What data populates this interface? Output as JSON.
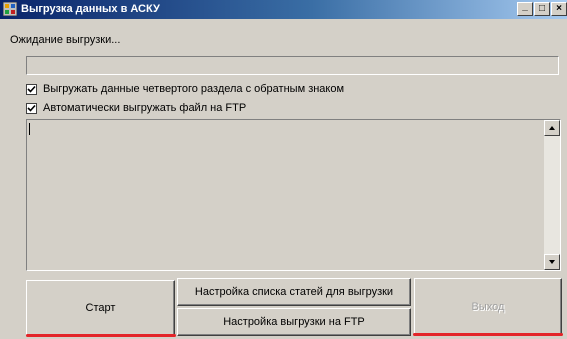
{
  "window": {
    "title": "Выгрузка данных в АСКУ",
    "controls": {
      "minimize": "_",
      "maximize": "□",
      "close": "×"
    }
  },
  "status": {
    "text": "Ожидание выгрузки..."
  },
  "progress": {
    "value_percent": 0
  },
  "options": {
    "export_fourth_section_negative": {
      "label": "Выгружать данные четвертого раздела с обратным знаком",
      "checked": true
    },
    "auto_upload_ftp": {
      "label": "Автоматически выгружать файл на FTP",
      "checked": true
    }
  },
  "log": {
    "text": ""
  },
  "buttons": {
    "start": "Старт",
    "article_list_settings": "Настройка списка статей для выгрузки",
    "ftp_settings": "Настройка выгрузки на FTP",
    "exit": "Выход"
  },
  "colors": {
    "accent_annotation": "#e3252a",
    "titlebar": "#0a246a",
    "face": "#d4d0c8"
  },
  "icons": {
    "app": "app-window-icon"
  }
}
